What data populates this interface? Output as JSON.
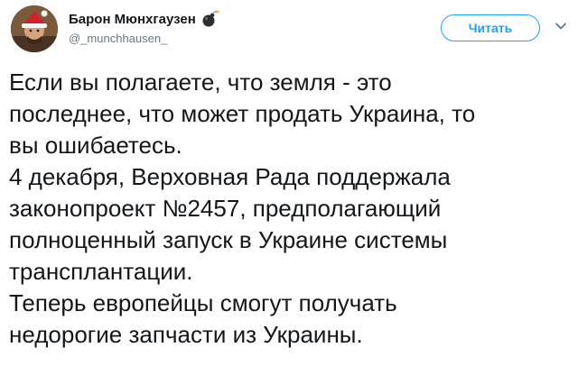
{
  "tweet": {
    "author": {
      "display_name": "Барон Мюнхгаузен",
      "handle": "@_munchhausen_",
      "badge_icon": "bomb-icon",
      "avatar_icon": "avatar-image"
    },
    "follow_label": "Читать",
    "menu_icon": "chevron-down-icon",
    "accent_color": "#1da1f2",
    "lines": [
      "Если вы полагаете, что земля - это",
      "последнее, что может продать Украина, то",
      "вы ошибаетесь.",
      "4 декабря, Верховная Рада поддержала",
      "законопроект №2457, предполагающий",
      "полноценный запуск в Украине системы",
      "трансплантации.",
      "Теперь европейцы смогут получать",
      "недорогие запчасти из Украины."
    ]
  }
}
